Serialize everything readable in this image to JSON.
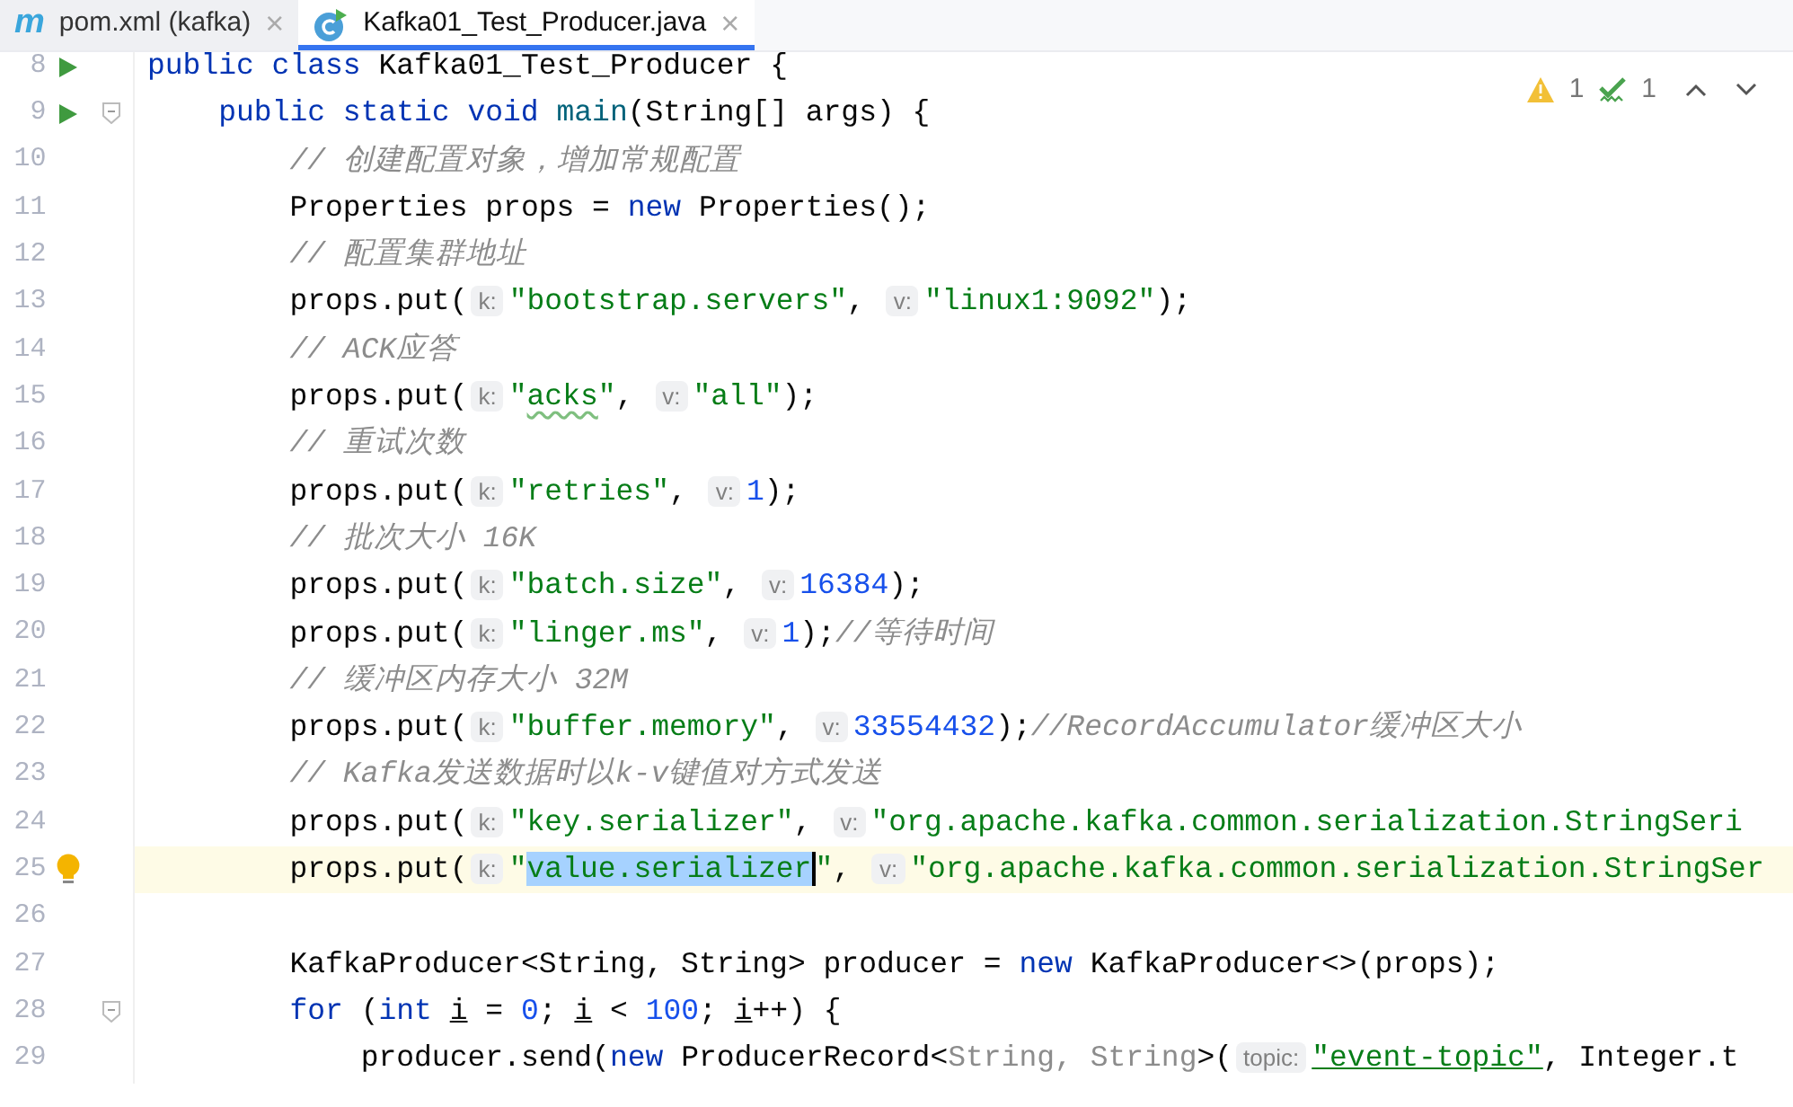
{
  "tabs": [
    {
      "kind": "maven",
      "icon_text": "m",
      "label": "pom.xml (kafka)",
      "close": "×",
      "selected": false
    },
    {
      "kind": "java-class",
      "label": "Kafka01_Test_Producer.java",
      "close": "×",
      "selected": true
    }
  ],
  "inspections": {
    "warnings": "1",
    "weak_warnings": "1"
  },
  "lines": [
    {
      "num": "8",
      "run": true,
      "fold": false,
      "bulb": false,
      "current": false,
      "tokens": [
        {
          "kind": "kw",
          "text": "public class "
        },
        {
          "kind": "plain",
          "text": "Kafka01_Test_Producer {"
        }
      ]
    },
    {
      "num": "9",
      "run": true,
      "fold": true,
      "bulb": false,
      "current": false,
      "tokens": [
        {
          "kind": "kw",
          "text": "    public static void "
        },
        {
          "kind": "method",
          "text": "main"
        },
        {
          "kind": "plain",
          "text": "(String[] args) {"
        }
      ]
    },
    {
      "num": "10",
      "run": false,
      "fold": false,
      "bulb": false,
      "current": false,
      "tokens": [
        {
          "kind": "comment",
          "text": "        // 创建配置对象，增加常规配置"
        }
      ]
    },
    {
      "num": "11",
      "run": false,
      "fold": false,
      "bulb": false,
      "current": false,
      "tokens": [
        {
          "kind": "plain",
          "text": "        Properties props = "
        },
        {
          "kind": "kw",
          "text": "new"
        },
        {
          "kind": "plain",
          "text": " Properties();"
        }
      ]
    },
    {
      "num": "12",
      "run": false,
      "fold": false,
      "bulb": false,
      "current": false,
      "tokens": [
        {
          "kind": "comment",
          "text": "        // 配置集群地址"
        }
      ]
    },
    {
      "num": "13",
      "run": false,
      "fold": false,
      "bulb": false,
      "current": false,
      "tokens": [
        {
          "kind": "plain",
          "text": "        props.put("
        },
        {
          "kind": "hint",
          "text": "k:"
        },
        {
          "kind": "str",
          "text": "\"bootstrap.servers\""
        },
        {
          "kind": "plain",
          "text": ", "
        },
        {
          "kind": "hint",
          "text": "v:"
        },
        {
          "kind": "str",
          "text": "\"linux1:9092\""
        },
        {
          "kind": "plain",
          "text": ");"
        }
      ]
    },
    {
      "num": "14",
      "run": false,
      "fold": false,
      "bulb": false,
      "current": false,
      "tokens": [
        {
          "kind": "comment",
          "text": "        // ACK应答"
        }
      ]
    },
    {
      "num": "15",
      "run": false,
      "fold": false,
      "bulb": false,
      "current": false,
      "tokens": [
        {
          "kind": "plain",
          "text": "        props.put("
        },
        {
          "kind": "hint",
          "text": "k:"
        },
        {
          "kind": "str",
          "text": "\""
        },
        {
          "kind": "typo",
          "text": "acks"
        },
        {
          "kind": "str",
          "text": "\""
        },
        {
          "kind": "plain",
          "text": ", "
        },
        {
          "kind": "hint",
          "text": "v:"
        },
        {
          "kind": "str",
          "text": "\"all\""
        },
        {
          "kind": "plain",
          "text": ");"
        }
      ]
    },
    {
      "num": "16",
      "run": false,
      "fold": false,
      "bulb": false,
      "current": false,
      "tokens": [
        {
          "kind": "comment",
          "text": "        // 重试次数"
        }
      ]
    },
    {
      "num": "17",
      "run": false,
      "fold": false,
      "bulb": false,
      "current": false,
      "tokens": [
        {
          "kind": "plain",
          "text": "        props.put("
        },
        {
          "kind": "hint",
          "text": "k:"
        },
        {
          "kind": "str",
          "text": "\"retries\""
        },
        {
          "kind": "plain",
          "text": ", "
        },
        {
          "kind": "hint",
          "text": "v:"
        },
        {
          "kind": "num",
          "text": "1"
        },
        {
          "kind": "plain",
          "text": ");"
        }
      ]
    },
    {
      "num": "18",
      "run": false,
      "fold": false,
      "bulb": false,
      "current": false,
      "tokens": [
        {
          "kind": "comment",
          "text": "        // 批次大小 16K"
        }
      ]
    },
    {
      "num": "19",
      "run": false,
      "fold": false,
      "bulb": false,
      "current": false,
      "tokens": [
        {
          "kind": "plain",
          "text": "        props.put("
        },
        {
          "kind": "hint",
          "text": "k:"
        },
        {
          "kind": "str",
          "text": "\"batch.size\""
        },
        {
          "kind": "plain",
          "text": ", "
        },
        {
          "kind": "hint",
          "text": "v:"
        },
        {
          "kind": "num",
          "text": "16384"
        },
        {
          "kind": "plain",
          "text": ");"
        }
      ]
    },
    {
      "num": "20",
      "run": false,
      "fold": false,
      "bulb": false,
      "current": false,
      "tokens": [
        {
          "kind": "plain",
          "text": "        props.put("
        },
        {
          "kind": "hint",
          "text": "k:"
        },
        {
          "kind": "str",
          "text": "\"linger.ms\""
        },
        {
          "kind": "plain",
          "text": ", "
        },
        {
          "kind": "hint",
          "text": "v:"
        },
        {
          "kind": "num",
          "text": "1"
        },
        {
          "kind": "plain",
          "text": ");"
        },
        {
          "kind": "comment",
          "text": "//等待时间"
        }
      ]
    },
    {
      "num": "21",
      "run": false,
      "fold": false,
      "bulb": false,
      "current": false,
      "tokens": [
        {
          "kind": "comment",
          "text": "        // 缓冲区内存大小 32M"
        }
      ]
    },
    {
      "num": "22",
      "run": false,
      "fold": false,
      "bulb": false,
      "current": false,
      "tokens": [
        {
          "kind": "plain",
          "text": "        props.put("
        },
        {
          "kind": "hint",
          "text": "k:"
        },
        {
          "kind": "str",
          "text": "\"buffer.memory\""
        },
        {
          "kind": "plain",
          "text": ", "
        },
        {
          "kind": "hint",
          "text": "v:"
        },
        {
          "kind": "num",
          "text": "33554432"
        },
        {
          "kind": "plain",
          "text": ");"
        },
        {
          "kind": "comment",
          "text": "//RecordAccumulator缓冲区大小"
        }
      ]
    },
    {
      "num": "23",
      "run": false,
      "fold": false,
      "bulb": false,
      "current": false,
      "tokens": [
        {
          "kind": "comment",
          "text": "        // Kafka发送数据时以k-v键值对方式发送"
        }
      ]
    },
    {
      "num": "24",
      "run": false,
      "fold": false,
      "bulb": false,
      "current": false,
      "tokens": [
        {
          "kind": "plain",
          "text": "        props.put("
        },
        {
          "kind": "hint",
          "text": "k:"
        },
        {
          "kind": "str",
          "text": "\"key.serializer\""
        },
        {
          "kind": "plain",
          "text": ", "
        },
        {
          "kind": "hint",
          "text": "v:"
        },
        {
          "kind": "str",
          "text": "\"org.apache.kafka.common.serialization.StringSeri"
        }
      ]
    },
    {
      "num": "25",
      "run": false,
      "fold": false,
      "bulb": true,
      "current": true,
      "tokens": [
        {
          "kind": "plain",
          "text": "        props.put("
        },
        {
          "kind": "hint",
          "text": "k:"
        },
        {
          "kind": "str",
          "text": "\""
        },
        {
          "kind": "selection",
          "text": "value.serializer"
        },
        {
          "kind": "str",
          "text": "\""
        },
        {
          "kind": "plain",
          "text": ", "
        },
        {
          "kind": "hint",
          "text": "v:"
        },
        {
          "kind": "str",
          "text": "\"org.apache.kafka.common.serialization.StringSer"
        }
      ]
    },
    {
      "num": "26",
      "run": false,
      "fold": false,
      "bulb": false,
      "current": false
    },
    {
      "num": "27",
      "run": false,
      "fold": false,
      "bulb": false,
      "current": false,
      "tokens": [
        {
          "kind": "plain",
          "text": "        KafkaProducer<String, String> producer = "
        },
        {
          "kind": "kw",
          "text": "new"
        },
        {
          "kind": "plain",
          "text": " KafkaProducer<>(props);"
        }
      ]
    },
    {
      "num": "28",
      "run": false,
      "fold": true,
      "bulb": false,
      "current": false,
      "tokens": [
        {
          "kind": "kw",
          "text": "        for"
        },
        {
          "kind": "plain",
          "text": " ("
        },
        {
          "kind": "kw",
          "text": "int "
        },
        {
          "kind": "var",
          "text": "i"
        },
        {
          "kind": "plain",
          "text": " = "
        },
        {
          "kind": "num",
          "text": "0"
        },
        {
          "kind": "plain",
          "text": "; "
        },
        {
          "kind": "var",
          "text": "i"
        },
        {
          "kind": "plain",
          "text": " < "
        },
        {
          "kind": "num",
          "text": "100"
        },
        {
          "kind": "plain",
          "text": "; "
        },
        {
          "kind": "var",
          "text": "i"
        },
        {
          "kind": "plain",
          "text": "++) {"
        }
      ]
    },
    {
      "num": "29",
      "run": false,
      "fold": false,
      "bulb": false,
      "current": false,
      "tokens": [
        {
          "kind": "plain",
          "text": "            producer.send("
        },
        {
          "kind": "kw",
          "text": "new"
        },
        {
          "kind": "plain",
          "text": " ProducerRecord<"
        },
        {
          "kind": "dim",
          "text": "String, String"
        },
        {
          "kind": "plain",
          "text": ">("
        },
        {
          "kind": "hint",
          "text": "topic:"
        },
        {
          "kind": "link",
          "text": "\"event-topic\""
        },
        {
          "kind": "plain",
          "text": ", Integer.t"
        }
      ]
    }
  ]
}
